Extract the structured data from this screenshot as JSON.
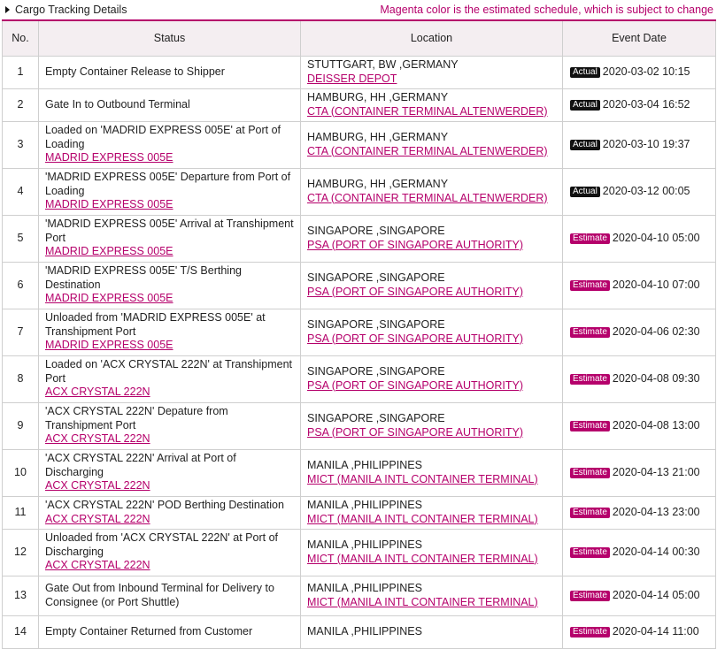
{
  "header": {
    "title": "Cargo Tracking Details",
    "note": "Magenta color is the estimated schedule, which is subject to change"
  },
  "columns": [
    "No.",
    "Status",
    "Location",
    "Event Date"
  ],
  "colors": {
    "accent": "#b5006b",
    "actual": "#111111",
    "header_bg": "#f4eef1"
  },
  "rows": [
    {
      "no": "1",
      "status": "Empty Container Release to Shipper",
      "status_link": "",
      "location": "STUTTGART, BW ,GERMANY",
      "location_link": "DEISSER DEPOT",
      "badge": "Actual",
      "date": "2020-03-02 10:15"
    },
    {
      "no": "2",
      "status": "Gate In to Outbound Terminal",
      "status_link": "",
      "location": "HAMBURG, HH ,GERMANY",
      "location_link": "CTA (CONTAINER TERMINAL ALTENWERDER)",
      "badge": "Actual",
      "date": "2020-03-04 16:52"
    },
    {
      "no": "3",
      "status": "Loaded on 'MADRID EXPRESS 005E' at Port of Loading",
      "status_link": "MADRID EXPRESS 005E",
      "location": "HAMBURG, HH ,GERMANY",
      "location_link": "CTA (CONTAINER TERMINAL ALTENWERDER)",
      "badge": "Actual",
      "date": "2020-03-10 19:37"
    },
    {
      "no": "4",
      "status": "'MADRID EXPRESS 005E' Departure from Port of Loading",
      "status_link": "MADRID EXPRESS 005E",
      "location": "HAMBURG, HH ,GERMANY",
      "location_link": "CTA (CONTAINER TERMINAL ALTENWERDER)",
      "badge": "Actual",
      "date": "2020-03-12 00:05"
    },
    {
      "no": "5",
      "status": "'MADRID EXPRESS 005E' Arrival at Transhipment Port",
      "status_link": "MADRID EXPRESS 005E",
      "location": "SINGAPORE ,SINGAPORE",
      "location_link": "PSA (PORT OF SINGAPORE AUTHORITY)",
      "badge": "Estimate",
      "date": "2020-04-10 05:00"
    },
    {
      "no": "6",
      "status": "'MADRID EXPRESS 005E' T/S Berthing Destination",
      "status_link": "MADRID EXPRESS 005E",
      "location": "SINGAPORE ,SINGAPORE",
      "location_link": "PSA (PORT OF SINGAPORE AUTHORITY)",
      "badge": "Estimate",
      "date": "2020-04-10 07:00"
    },
    {
      "no": "7",
      "status": "Unloaded from 'MADRID EXPRESS 005E' at Transhipment Port",
      "status_link": "MADRID EXPRESS 005E",
      "location": "SINGAPORE ,SINGAPORE",
      "location_link": "PSA (PORT OF SINGAPORE AUTHORITY)",
      "badge": "Estimate",
      "date": "2020-04-06 02:30"
    },
    {
      "no": "8",
      "status": "Loaded on 'ACX CRYSTAL 222N' at Transhipment Port",
      "status_link": "ACX CRYSTAL 222N",
      "location": "SINGAPORE ,SINGAPORE",
      "location_link": "PSA (PORT OF SINGAPORE AUTHORITY)",
      "badge": "Estimate",
      "date": "2020-04-08 09:30"
    },
    {
      "no": "9",
      "status": "'ACX CRYSTAL 222N' Depature from Transhipment Port",
      "status_link": "ACX CRYSTAL 222N",
      "location": "SINGAPORE ,SINGAPORE",
      "location_link": "PSA (PORT OF SINGAPORE AUTHORITY)",
      "badge": "Estimate",
      "date": "2020-04-08 13:00"
    },
    {
      "no": "10",
      "status": "'ACX CRYSTAL 222N' Arrival at Port of Discharging",
      "status_link": "ACX CRYSTAL 222N",
      "location": "MANILA ,PHILIPPINES",
      "location_link": "MICT (MANILA INTL CONTAINER TERMINAL)",
      "badge": "Estimate",
      "date": "2020-04-13 21:00"
    },
    {
      "no": "11",
      "status": "'ACX CRYSTAL 222N' POD Berthing Destination",
      "status_link": "ACX CRYSTAL 222N",
      "location": "MANILA ,PHILIPPINES",
      "location_link": "MICT (MANILA INTL CONTAINER TERMINAL)",
      "badge": "Estimate",
      "date": "2020-04-13 23:00"
    },
    {
      "no": "12",
      "status": "Unloaded from 'ACX CRYSTAL 222N' at Port of Discharging",
      "status_link": "ACX CRYSTAL 222N",
      "location": "MANILA ,PHILIPPINES",
      "location_link": "MICT (MANILA INTL CONTAINER TERMINAL)",
      "badge": "Estimate",
      "date": "2020-04-14 00:30"
    },
    {
      "no": "13",
      "status": "Gate Out from Inbound Terminal for Delivery to Consignee (or Port Shuttle)",
      "status_link": "",
      "location": "MANILA ,PHILIPPINES",
      "location_link": "MICT (MANILA INTL CONTAINER TERMINAL)",
      "badge": "Estimate",
      "date": "2020-04-14 05:00"
    },
    {
      "no": "14",
      "status": "Empty Container Returned from Customer",
      "status_link": "",
      "location": "MANILA ,PHILIPPINES",
      "location_link": "",
      "badge": "Estimate",
      "date": "2020-04-14 11:00"
    }
  ]
}
